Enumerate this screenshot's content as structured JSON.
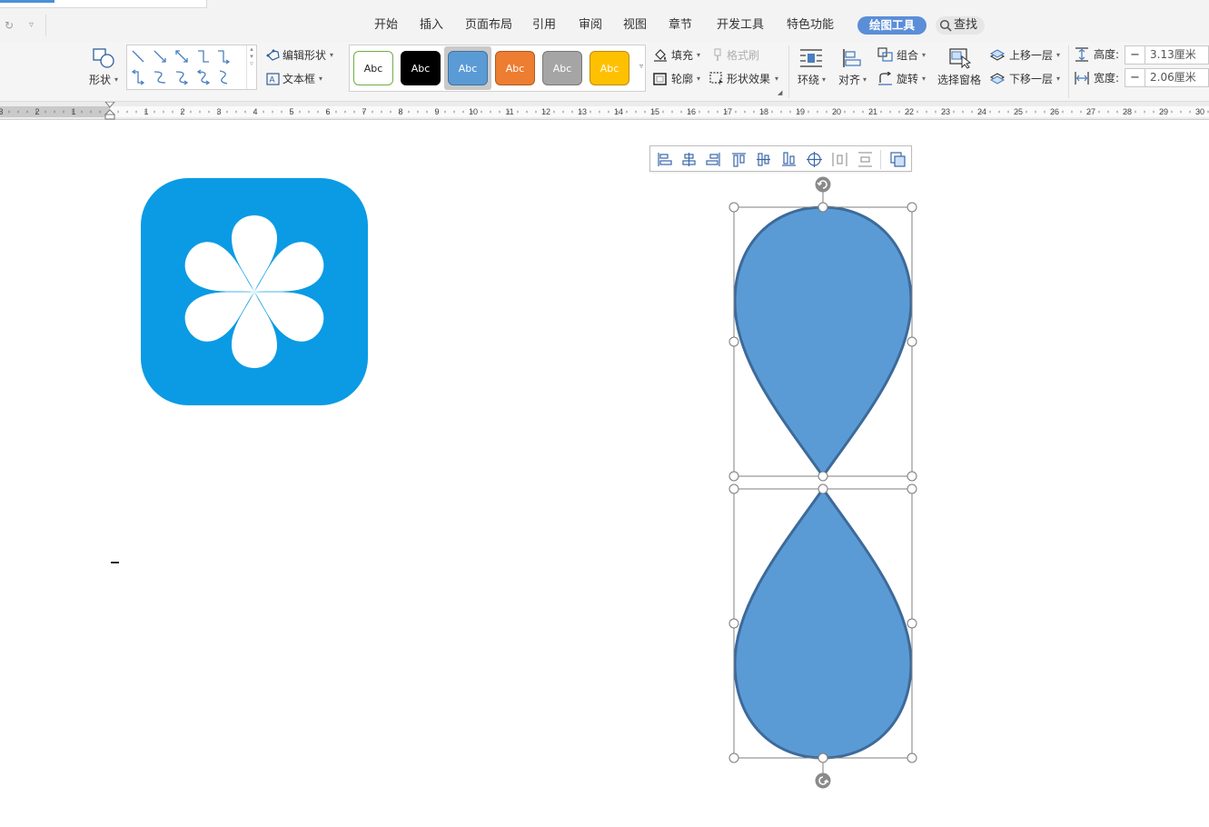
{
  "menu": {
    "items": [
      "开始",
      "插入",
      "页面布局",
      "引用",
      "审阅",
      "视图",
      "章节",
      "开发工具",
      "特色功能"
    ],
    "active_tab": "绘图工具",
    "search_label": "查找"
  },
  "ribbon": {
    "shapes_label": "形状",
    "edit_shape_label": "编辑形状",
    "textbox_label": "文本框",
    "style_boxes": [
      {
        "label": "Abc",
        "bg": "#ffffff",
        "fg": "#222222",
        "border": "#70ad47"
      },
      {
        "label": "Abc",
        "bg": "#000000",
        "fg": "#ffffff",
        "border": "#000000"
      },
      {
        "label": "Abc",
        "bg": "#5b9bd5",
        "fg": "#ffffff",
        "border": "#41719c"
      },
      {
        "label": "Abc",
        "bg": "#ed7d31",
        "fg": "#ffffff",
        "border": "#ae5a21"
      },
      {
        "label": "Abc",
        "bg": "#a5a5a5",
        "fg": "#ffffff",
        "border": "#787878"
      },
      {
        "label": "Abc",
        "bg": "#ffc000",
        "fg": "#ffffff",
        "border": "#bc8c00"
      }
    ],
    "fill_label": "填充",
    "format_painter_label": "格式刷",
    "outline_label": "轮廓",
    "shape_effects_label": "形状效果",
    "wrap_label": "环绕",
    "align_label": "对齐",
    "group_label": "组合",
    "rotate_label": "旋转",
    "selection_pane_label": "选择窗格",
    "bring_forward_label": "上移一层",
    "send_backward_label": "下移一层",
    "height_label": "高度:",
    "height_value": "3.13厘米",
    "width_label": "宽度:",
    "width_value": "2.06厘米"
  },
  "ruler": {
    "numbers": [
      "3",
      "2",
      "1",
      "1",
      "2",
      "3",
      "4",
      "5",
      "6",
      "7",
      "8",
      "9",
      "10",
      "11",
      "12",
      "13",
      "14",
      "15",
      "16",
      "17",
      "18",
      "19",
      "20",
      "21",
      "22",
      "23",
      "24",
      "25",
      "26",
      "27",
      "28",
      "29",
      "30"
    ]
  },
  "colors": {
    "logo_blue": "#0a9be4",
    "shape_fill": "#5b9bd5",
    "shape_outline": "#3d6a9a",
    "active_tab": "#5b8ed8"
  },
  "icons": [
    "undo-icon",
    "customize-icon",
    "search-icon",
    "shapes-icon",
    "edit-shape-icon",
    "textbox-icon",
    "fill-icon",
    "format-painter-icon",
    "outline-icon",
    "shape-effects-icon",
    "wrap-icon",
    "align-icon",
    "group-icon",
    "rotate-icon",
    "selection-pane-icon",
    "bring-forward-icon",
    "send-backward-icon",
    "height-icon",
    "width-icon",
    "rotate-handle-icon",
    "flower-logo-icon"
  ]
}
